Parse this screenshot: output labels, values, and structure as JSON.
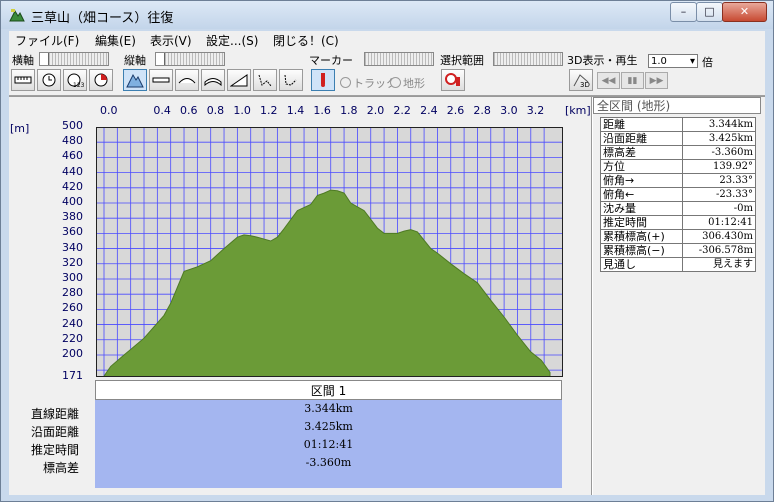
{
  "window": {
    "title": "三草山（畑コース）往復",
    "min_label": "–",
    "max_label": "□",
    "close_label": "✕"
  },
  "menu": [
    {
      "label": "ファイル(F)"
    },
    {
      "label": "編集(E)"
    },
    {
      "label": "表示(V)"
    },
    {
      "label": "設定...(S)"
    },
    {
      "label": "閉じる！(C)"
    }
  ],
  "toolbar": {
    "h_axis_label": "横軸",
    "v_axis_label": "縦軸",
    "marker_label": "マーカー",
    "range_label": "選択範囲",
    "playback_label": "3D表示・再生",
    "speed_value": "1.0",
    "speed_unit": "倍",
    "radio_track": "トラック",
    "radio_terrain": "地形",
    "playback_buttons": [
      "◀◀",
      "▮▮",
      "▶▶"
    ]
  },
  "chart_data": {
    "type": "area",
    "x_unit": "[km]",
    "y_unit": "[m]",
    "xlim": [
      0,
      3.344
    ],
    "ylim": [
      171,
      500
    ],
    "x_ticks": [
      "0.0",
      "0.4",
      "0.6",
      "0.8",
      "1.0",
      "1.2",
      "1.4",
      "1.6",
      "1.8",
      "2.0",
      "2.2",
      "2.4",
      "2.6",
      "2.8",
      "3.0",
      "3.2"
    ],
    "y_ticks": [
      "500",
      "480",
      "460",
      "440",
      "420",
      "400",
      "380",
      "360",
      "340",
      "320",
      "300",
      "280",
      "260",
      "240",
      "220",
      "200",
      "171"
    ],
    "fill_color": "#6b9b37",
    "grid_color": "#4a4aff",
    "background": "#d8d8d8",
    "x": [
      0,
      0.05,
      0.15,
      0.3,
      0.45,
      0.5,
      0.6,
      0.7,
      0.8,
      0.9,
      1.0,
      1.05,
      1.1,
      1.15,
      1.25,
      1.3,
      1.35,
      1.45,
      1.55,
      1.6,
      1.65,
      1.7,
      1.75,
      1.8,
      1.85,
      1.95,
      2.05,
      2.1,
      2.2,
      2.25,
      2.3,
      2.35,
      2.45,
      2.5,
      2.6,
      2.7,
      2.8,
      2.9,
      3.0,
      3.1,
      3.2,
      3.28,
      3.344
    ],
    "y": [
      172,
      185,
      200,
      222,
      252,
      268,
      310,
      316,
      324,
      340,
      355,
      358,
      357,
      355,
      350,
      355,
      366,
      390,
      398,
      410,
      413,
      417,
      416,
      413,
      400,
      390,
      367,
      360,
      360,
      363,
      365,
      362,
      340,
      334,
      320,
      307,
      295,
      272,
      250,
      226,
      204,
      193,
      177
    ]
  },
  "section": {
    "header": "区間 1",
    "labels": [
      "直線距離",
      "沿面距離",
      "推定時間",
      "標高差"
    ],
    "values": [
      "3.344km",
      "3.425km",
      "01:12:41",
      "-3.360m"
    ]
  },
  "side": {
    "header": "全区間 (地形)",
    "rows": [
      {
        "label": "距離",
        "value": "3.344km"
      },
      {
        "label": "沿面距離",
        "value": "3.425km"
      },
      {
        "label": "標高差",
        "value": "-3.360m"
      },
      {
        "label": "方位",
        "value": "139.92°"
      },
      {
        "label": "俯角→",
        "value": "23.33°"
      },
      {
        "label": "俯角←",
        "value": "-23.33°"
      },
      {
        "label": "沈み量",
        "value": "-0m"
      },
      {
        "label": "推定時間",
        "value": "01:12:41"
      },
      {
        "label": "累積標高(+)",
        "value": "306.430m"
      },
      {
        "label": "累積標高(−)",
        "value": "-306.578m"
      },
      {
        "label": "見通し",
        "value": "見えます"
      }
    ]
  }
}
